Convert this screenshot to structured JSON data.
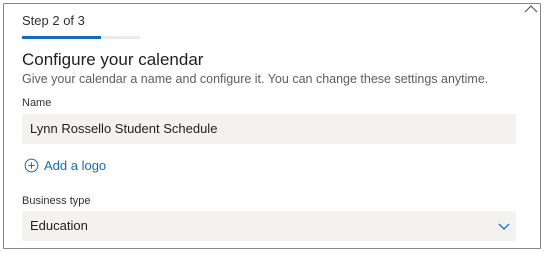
{
  "wizard": {
    "step_label": "Step 2 of 3",
    "progress_fraction": 0.667,
    "title": "Configure your calendar",
    "description": "Give your calendar a name and configure it. You can change these settings anytime."
  },
  "name_field": {
    "label": "Name",
    "value": "Lynn Rossello Student Schedule"
  },
  "add_logo": {
    "label": "Add a logo",
    "icon": "add-circle-icon"
  },
  "business_type": {
    "label": "Business type",
    "selected": "Education",
    "icon": "chevron-down-icon"
  },
  "colors": {
    "accent": "#106ebe",
    "field_background": "#f3f2f1",
    "progress_track": "#edebe9"
  }
}
